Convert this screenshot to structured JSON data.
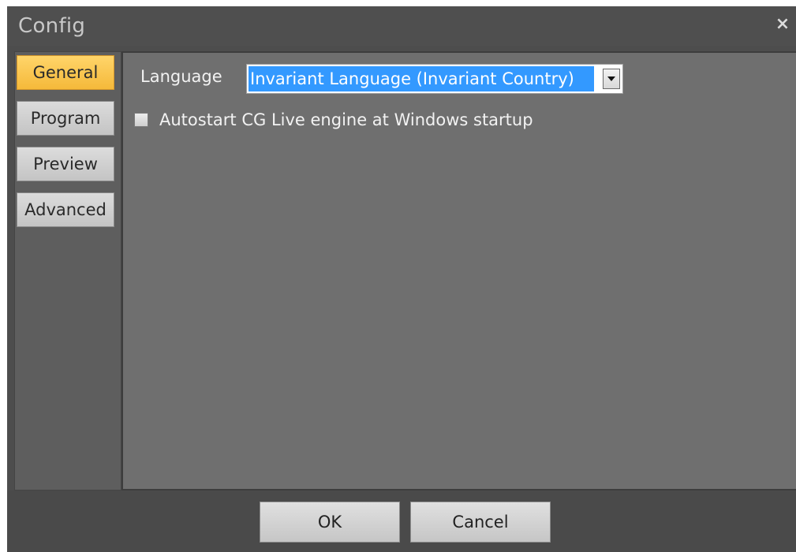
{
  "window": {
    "title": "Config",
    "close_glyph": "×"
  },
  "sidebar": {
    "items": [
      {
        "label": "General",
        "active": true
      },
      {
        "label": "Program",
        "active": false
      },
      {
        "label": "Preview",
        "active": false
      },
      {
        "label": "Advanced",
        "active": false
      }
    ]
  },
  "general": {
    "language_label": "Language",
    "language_value": "Invariant Language (Invariant Country)",
    "autostart_label": "Autostart CG Live engine at Windows startup",
    "autostart_checked": false
  },
  "footer": {
    "ok_label": "OK",
    "cancel_label": "Cancel"
  },
  "colors": {
    "active_tab": "#f5b93a",
    "selection": "#3399ff",
    "content_bg": "#6f6f6f",
    "frame_bg": "#4d4d4d"
  },
  "icons": {
    "close": "close-icon",
    "dropdown": "chevron-down-icon"
  }
}
